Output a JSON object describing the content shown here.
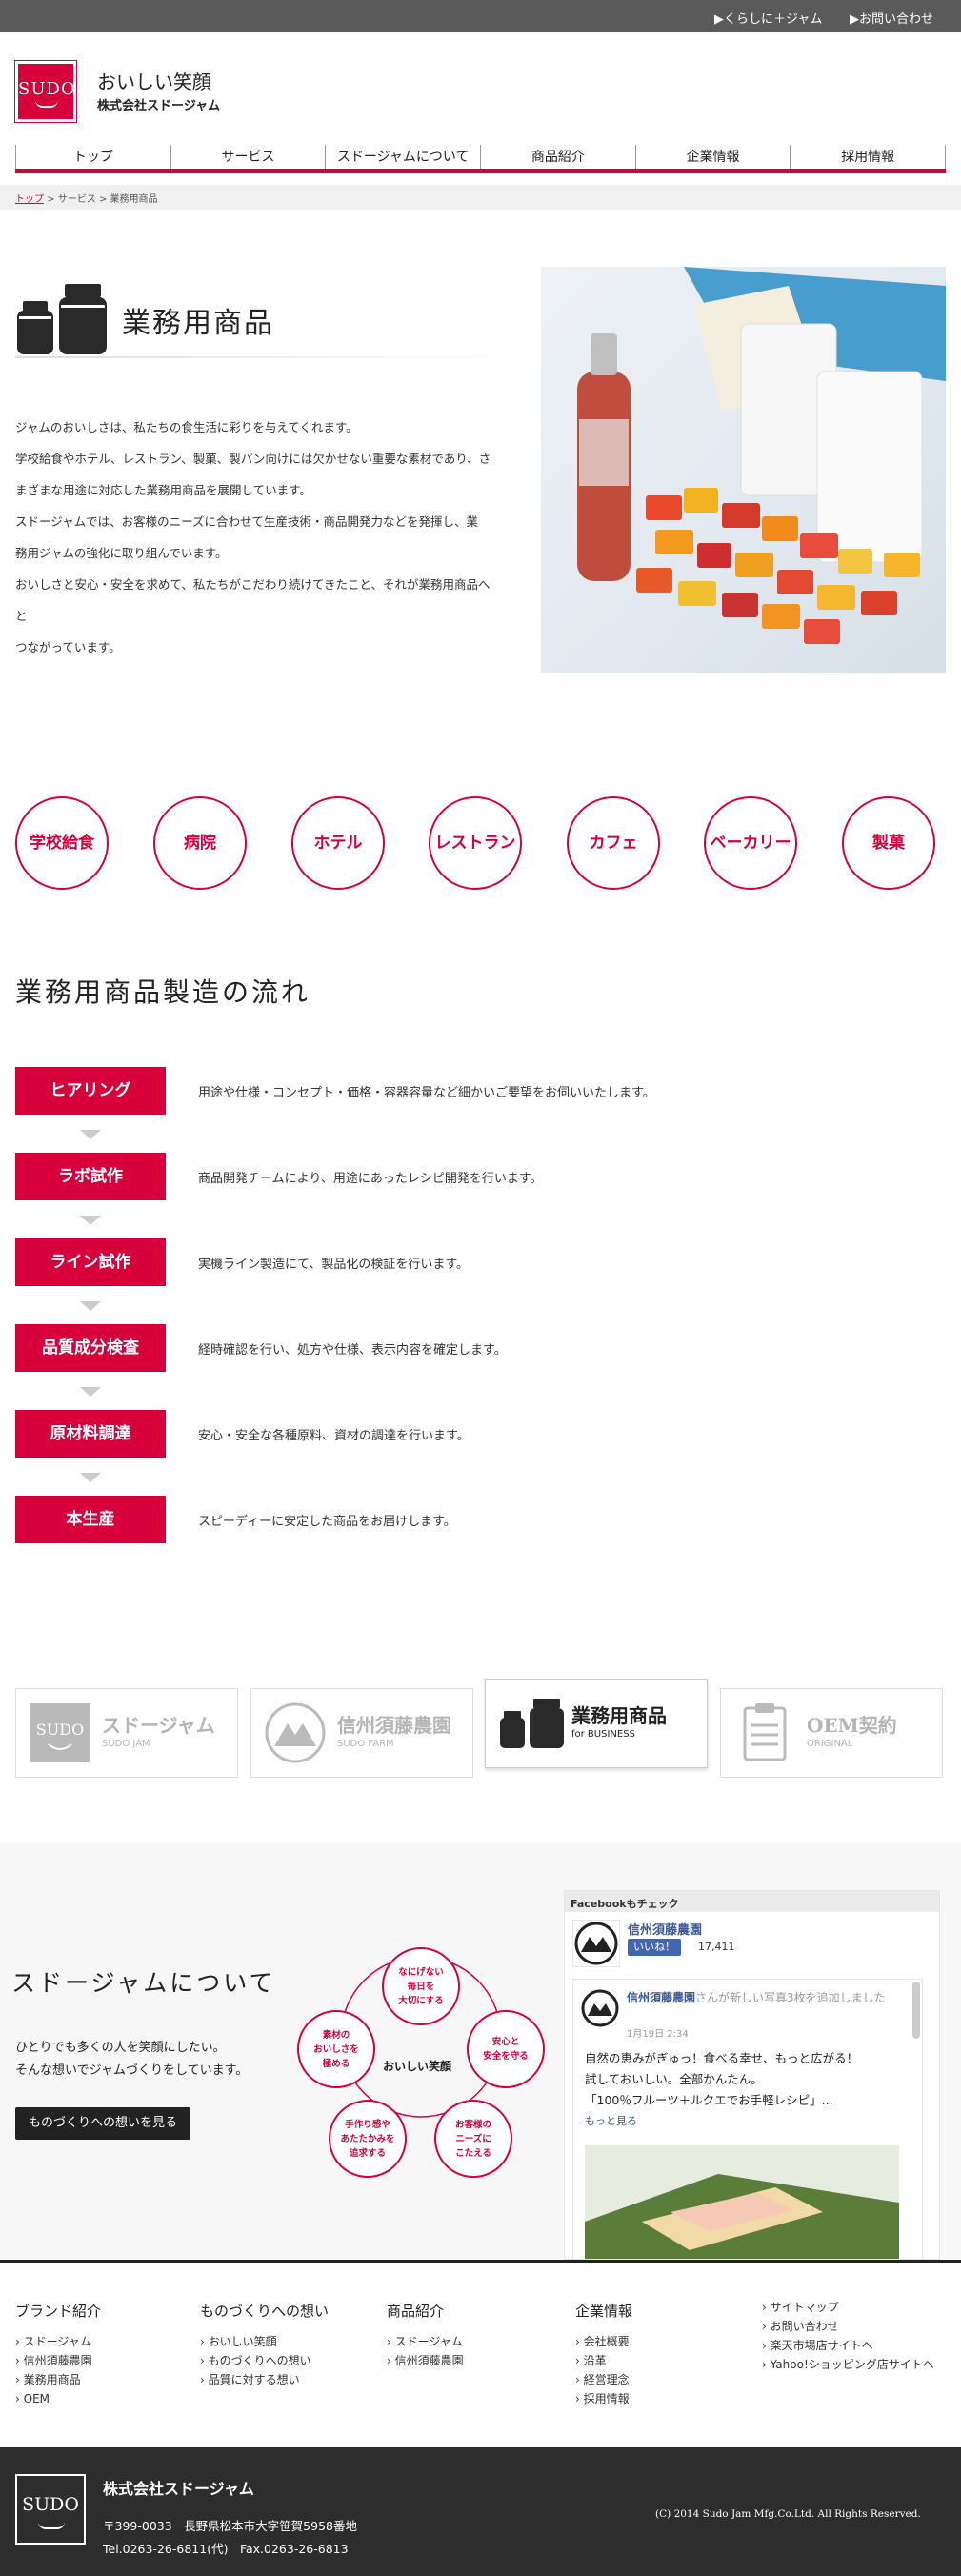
{
  "topbar": {
    "link1": "▶くらしに＋ジャム",
    "link2": "▶お問い合わせ"
  },
  "brand": {
    "logo": "SUDO",
    "tagline": "おいしい笑顔",
    "company": "株式会社スドージャム"
  },
  "nav": [
    "トップ",
    "サービス",
    "スドージャムについて",
    "商品紹介",
    "企業情報",
    "採用情報"
  ],
  "breadcrumb": {
    "home": "トップ",
    "mid": "サービス",
    "current": "業務用商品"
  },
  "page": {
    "title": "業務用商品",
    "intro": [
      "ジャムのおいしさは、私たちの食生活に彩りを与えてくれます。",
      "学校給食やホテル、レストラン、製菓、製パン向けには欠かせない重要な素材であり、さ",
      "まざまな用途に対応した業務用商品を展開しています。",
      "スドージャムでは、お客様のニーズに合わせて生産技術・商品開発力などを発揮し、業",
      "務用ジャムの強化に取り組んでいます。",
      "おいしさと安心・安全を求めて、私たちがこだわり続けてきたこと、それが業務用商品へと",
      "つながっています。"
    ]
  },
  "categories": [
    "学校給食",
    "病院",
    "ホテル",
    "レストラン",
    "カフェ",
    "ベーカリー",
    "製菓"
  ],
  "flow": {
    "title": "業務用商品製造の流れ",
    "steps": [
      {
        "label": "ヒアリング",
        "desc": "用途や仕様・コンセプト・価格・容器容量など細かいご要望をお伺いいたします。"
      },
      {
        "label": "ラボ試作",
        "desc": "商品開発チームにより、用途にあったレシピ開発を行います。"
      },
      {
        "label": "ライン試作",
        "desc": "実機ライン製造にて、製品化の検証を行います。"
      },
      {
        "label": "品質成分検査",
        "desc": "経時確認を行い、処方や仕様、表示内容を確定します。"
      },
      {
        "label": "原材料調達",
        "desc": "安心・安全な各種原料、資材の調達を行います。"
      },
      {
        "label": "本生産",
        "desc": "スピーディーに安定した商品をお届けします。"
      }
    ]
  },
  "brands": [
    {
      "name": "スドージャム",
      "sub": "SUDO JAM"
    },
    {
      "name": "信州須藤農園",
      "sub": "SUDO FARM"
    },
    {
      "name": "業務用商品",
      "sub": "for BUSINESS"
    },
    {
      "name": "OEM契約",
      "sub": "ORIGINAL"
    }
  ],
  "about": {
    "title": "スドージャムについて",
    "text1": "ひとりでも多くの人を笑顔にしたい。",
    "text2": "そんな想いでジャムづくりをしています。",
    "button": "ものづくりへの想いを見る",
    "center": "おいしい笑顔",
    "values": [
      "なにげない\n毎日を\n大切にする",
      "安心と\n安全を守る",
      "お客様の\nニーズに\nこたえる",
      "手作り感や\nあたたかみを\n追求する",
      "素材の\nおいしさを\n極める"
    ]
  },
  "facebook": {
    "header": "Facebookもチェック",
    "page": "信州須藤農園",
    "like": "いいね！",
    "likes": "17,411",
    "post_author": "信州須藤農園",
    "post_action": "さんが新しい写真3枚を追加しました",
    "post_date": "1月19日 2:34",
    "post_line1": "自然の恵みがぎゅっ！食べる幸せ、もっと広がる！",
    "post_line2": "試しておいしい。全部かんたん。",
    "post_line3": "「100％フルーツ＋ルクエでお手軽レシピ」...",
    "more": "もっと見る"
  },
  "footer": {
    "cols": [
      {
        "head": "ブランド紹介",
        "items": [
          "スドージャム",
          "信州須藤農園",
          "業務用商品",
          "OEM"
        ]
      },
      {
        "head": "ものづくりへの想い",
        "items": [
          "おいしい笑顔",
          "ものづくりへの想い",
          "品質に対する想い"
        ]
      },
      {
        "head": "商品紹介",
        "items": [
          "スドージャム",
          "信州須藤農園"
        ]
      },
      {
        "head": "企業情報",
        "items": [
          "会社概要",
          "沿革",
          "経営理念",
          "採用情報"
        ]
      }
    ],
    "extra": [
      "サイトマップ",
      "お問い合わせ",
      "楽天市場店サイトへ",
      "Yahoo!ショッピング店サイトへ"
    ],
    "company": "株式会社スドージャム",
    "address": "〒399-0033　長野県松本市大字笹賀5958番地",
    "tel": "Tel.0263-26-6811(代)　Fax.0263-26-6813",
    "copyright": "(C) 2014  Sudo Jam Mfg.Co.Ltd. All Rights Reserved."
  },
  "colors": {
    "accent": "#d8003a",
    "dark": "#2d2d2d"
  }
}
